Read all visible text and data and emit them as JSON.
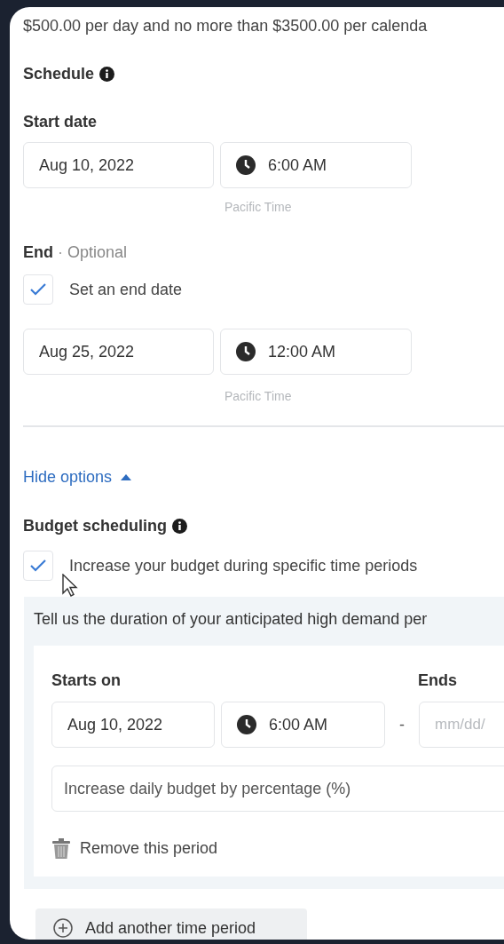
{
  "budget_note": "$500.00 per day and no more than $3500.00 per calenda",
  "schedule": {
    "title": "Schedule",
    "start": {
      "label": "Start date",
      "date": "Aug 10, 2022",
      "time": "6:00 AM",
      "timezone": "Pacific Time"
    },
    "end": {
      "label": "End",
      "separator": "·",
      "optional": "Optional",
      "checkbox": {
        "label": "Set an end date",
        "checked": true
      },
      "date": "Aug 25, 2022",
      "time": "12:00 AM",
      "timezone": "Pacific Time"
    }
  },
  "hide_options": "Hide options",
  "budget_scheduling": {
    "title": "Budget scheduling",
    "checkbox": {
      "label": "Increase your budget during specific time periods",
      "checked": true
    },
    "description": "Tell us the duration of your anticipated high demand per",
    "periods": [
      {
        "starts_label": "Starts on",
        "date": "Aug 10, 2022",
        "time": "6:00 AM",
        "separator": "-",
        "ends_label": "Ends",
        "end_date_placeholder": "mm/dd/",
        "percentage_placeholder": "Increase daily budget by percentage (%)",
        "remove": "Remove this period"
      }
    ],
    "add_button": "Add another time period"
  }
}
